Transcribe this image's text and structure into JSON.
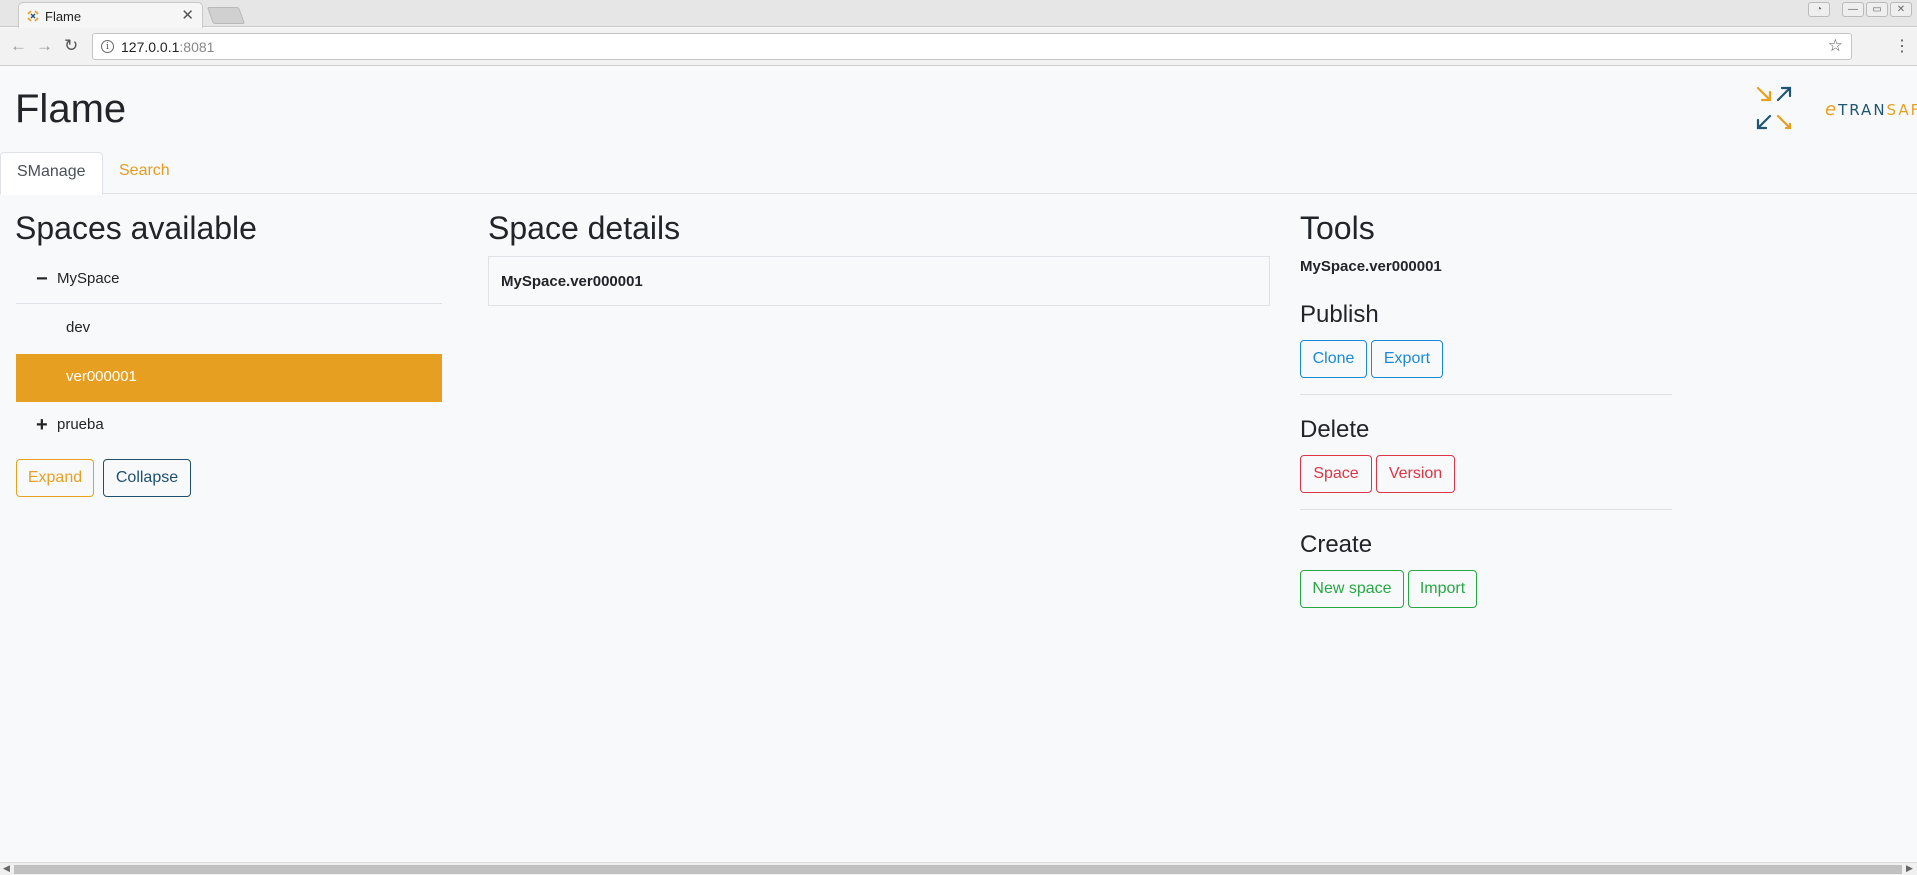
{
  "browser": {
    "tab_title": "Flame",
    "tab_close": "✕",
    "url_host": "127.0.0.1",
    "url_port": ":8081"
  },
  "app": {
    "title": "Flame",
    "logo": {
      "e": "e",
      "tran": "TRAN",
      "safe": "SAFE"
    }
  },
  "navtabs": {
    "manage": "SManage",
    "search": "Search"
  },
  "spaces": {
    "heading": "Spaces available",
    "tree": [
      {
        "label": "MySpace",
        "icon": "−"
      },
      {
        "label": "dev"
      },
      {
        "label": "ver000001"
      },
      {
        "label": "prueba",
        "icon": "+"
      }
    ],
    "expand_label": "Expand",
    "collapse_label": "Collapse"
  },
  "details": {
    "heading": "Space details",
    "name": "MySpace.ver000001"
  },
  "tools": {
    "heading": "Tools",
    "selected": "MySpace.ver000001",
    "publish": {
      "heading": "Publish",
      "clone": "Clone",
      "export": "Export"
    },
    "delete": {
      "heading": "Delete",
      "space": "Space",
      "version": "Version"
    },
    "create": {
      "heading": "Create",
      "new_space": "New space",
      "import": "Import"
    }
  },
  "colors": {
    "accent": "#e69f21",
    "brand_dark": "#1f5673"
  }
}
